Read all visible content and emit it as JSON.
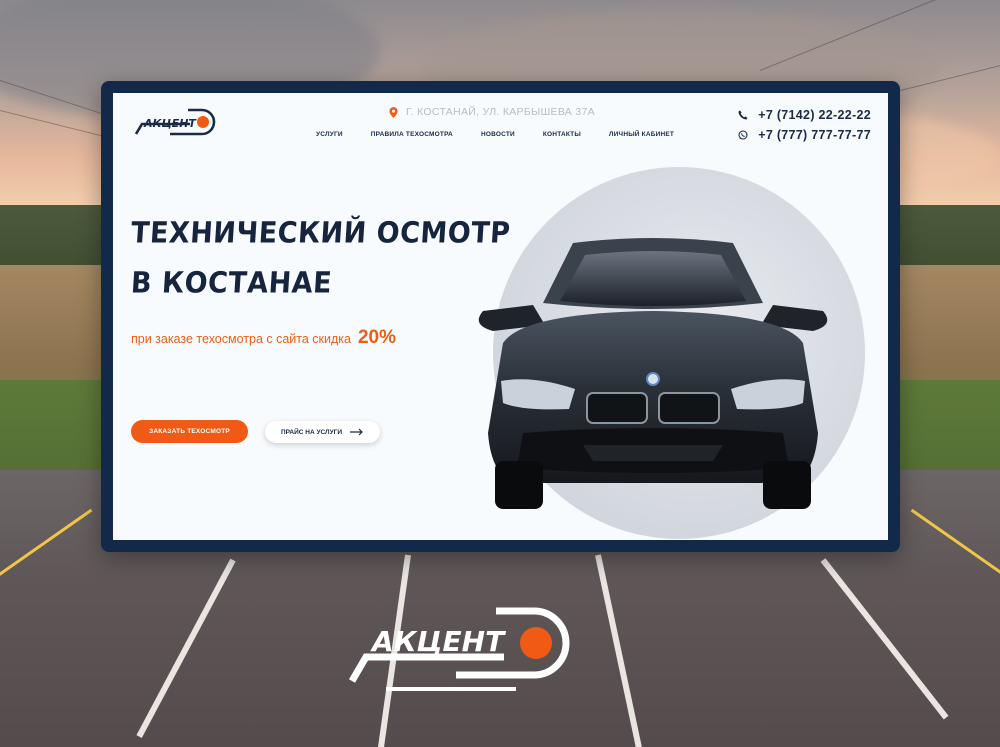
{
  "brand": {
    "name": "АКЦЕНТ",
    "logo_accent": "#f05a14",
    "logo_color": "#1b2b45"
  },
  "header": {
    "address": "Г. КОСТАНАЙ, УЛ. КАРБЫШЕВА 37А",
    "nav": [
      "УСЛУГИ",
      "ПРАВИЛА ТЕХОСМОТРА",
      "НОВОСТИ",
      "КОНТАКТЫ",
      "ЛИЧНЫЙ КАБИНЕТ"
    ],
    "phones": [
      {
        "icon": "phone-icon",
        "number": "+7 (7142) 22-22-22"
      },
      {
        "icon": "whatsapp-icon",
        "number": "+7 (777) 777-77-77"
      }
    ]
  },
  "hero": {
    "title_line1": "ТЕХНИЧЕСКИЙ ОСМОТР",
    "title_line2": "В КОСТАНАЕ",
    "promo_text": "при заказе техосмотра с сайта скидка",
    "promo_value": "20%",
    "order_button": "ЗАКАЗАТЬ ТЕХОСМОТР",
    "price_button": "ПРАЙС НА УСЛУГИ"
  },
  "colors": {
    "accent": "#f05a14",
    "navy": "#16243e",
    "frame": "#13294a"
  }
}
